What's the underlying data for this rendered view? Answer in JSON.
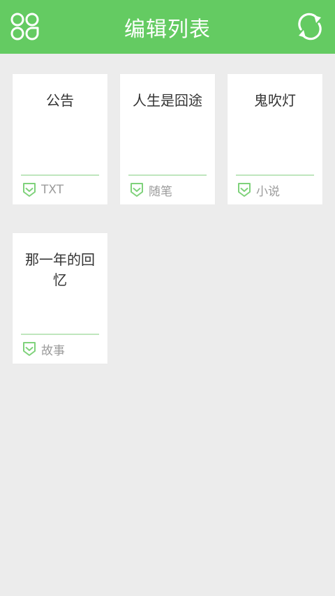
{
  "header": {
    "title": "编辑列表",
    "menu_icon": "apps-grid-icon",
    "refresh_icon": "refresh-icon",
    "color": "#64cb62"
  },
  "cards": [
    {
      "title": "公告",
      "tag": "TXT"
    },
    {
      "title": "人生是囧途",
      "tag": "随笔"
    },
    {
      "title": "鬼吹灯",
      "tag": "小说"
    },
    {
      "title": "那一年的回忆",
      "tag": "故事"
    }
  ],
  "colors": {
    "background": "#ececec",
    "card": "#ffffff",
    "divider": "#bfe6bd",
    "tag_icon": "#7fd27b",
    "tag_text": "#9b9b9b"
  }
}
